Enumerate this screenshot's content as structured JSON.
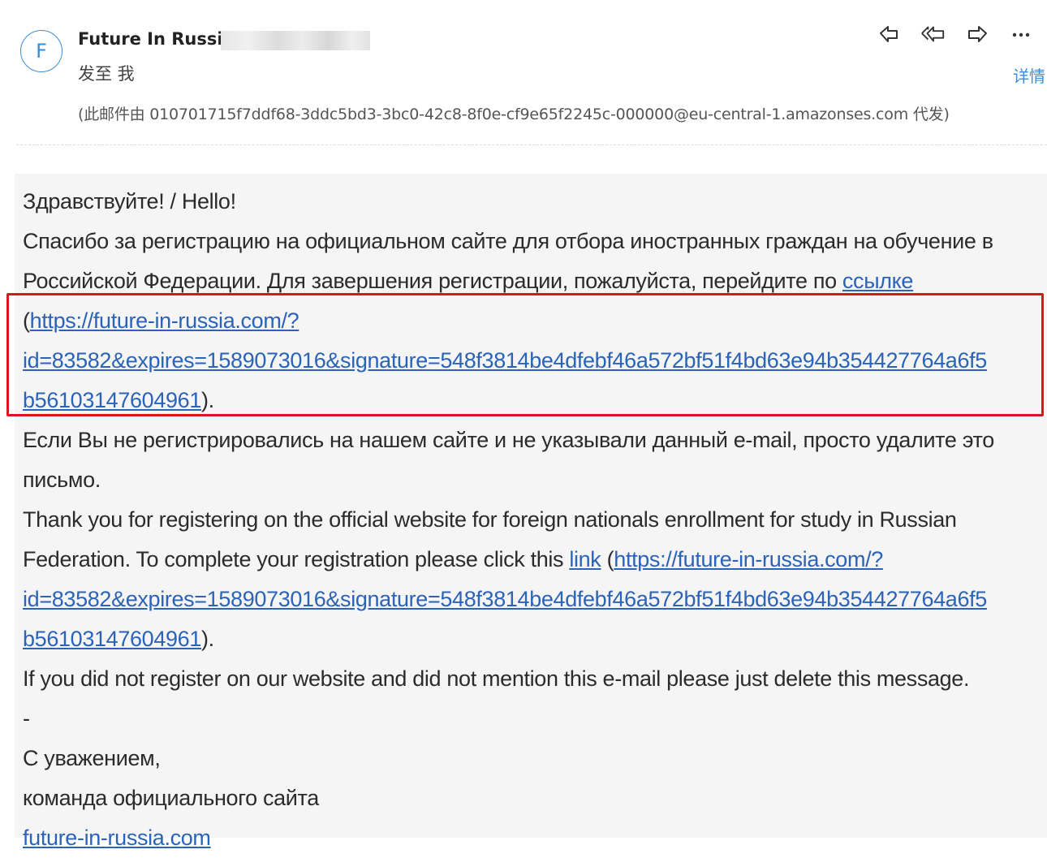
{
  "header": {
    "avatar_letter": "F",
    "sender_name": "Future In Russia",
    "recipient": "发至 我",
    "details_label": "详情",
    "sent_via": "(此邮件由 010701715f7ddf68-3ddc5bd3-3bc0-42c8-8f0e-cf9e65f2245c-000000@eu-central-1.amazonses.com 代发)",
    "actions": [
      "reply-icon",
      "reply-all-icon",
      "forward-icon",
      "more-icon"
    ],
    "accent_color": "#3a8ed8"
  },
  "body": {
    "greeting": "Здравствуйте! / Hello!",
    "ru_para_line1": "Спасибо за регистрацию на официальном сайте для отбора иностранных граждан на обучение в",
    "ru_para_line2": "Российской Федерации. Для завершения регистрации, пожалуйста, перейдите по ",
    "ru_link_text": "ссылке",
    "ru_url_part1": "https://future-in-russia.com/?",
    "ru_url_part2": "id=83582&expires=1589073016&signature=548f3814be4dfebf46a572bf51f4bd63e94b354427764a6f5",
    "ru_url_part3": "b56103147604961",
    "open_paren": "(",
    "close_paren_period": ").",
    "ru_ignore_line1": "Если Вы не регистрировались на нашем сайте и не указывали данный e-mail, просто удалите это",
    "ru_ignore_line2": "письмо.",
    "en_para_line1": "Thank you for registering on the official website for foreign nationals enrollment for study in Russian",
    "en_para_line2": "Federation. To complete your registration please click this ",
    "en_link_text": "link",
    "en_url_part1": "https://future-in-russia.com/?",
    "en_url_part2": "id=83582&expires=1589073016&signature=548f3814be4dfebf46a572bf51f4bd63e94b354427764a6f5",
    "en_url_part3": "b56103147604961",
    "en_ignore": "If you did not register on our website and did not mention this e-mail please just delete this message.",
    "dash": "-",
    "sign_regards": "С уважением,",
    "sign_team": "команда официального сайта",
    "sign_site": "future-in-russia.com",
    "link_color": "#2a63b8",
    "highlight_color": "#d6171e"
  }
}
